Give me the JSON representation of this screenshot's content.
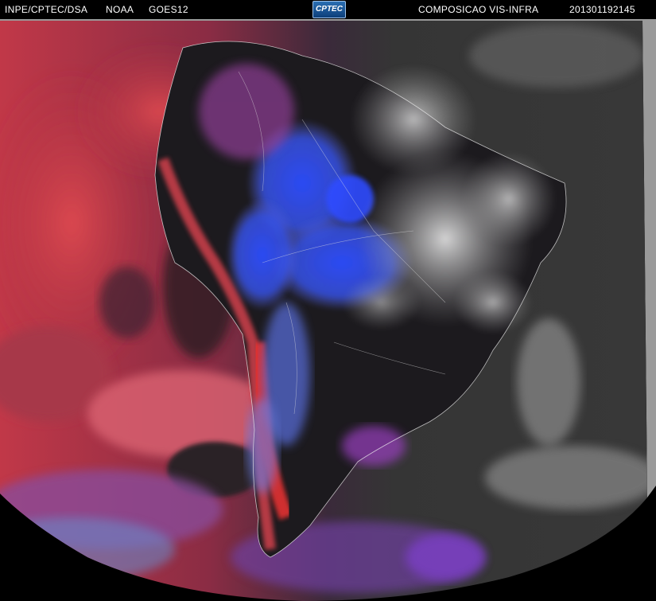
{
  "header": {
    "agency": "INPE/CPTEC/DSA",
    "provider": "NOAA",
    "satellite": "GOES12",
    "logo_text": "CPTEC",
    "product": "COMPOSICAO VIS-INFRA",
    "timestamp": "201301192145"
  },
  "colors": {
    "background": "#000000",
    "ocean_infra": "#c23a4a",
    "ocean_visible": "#3b3b3b",
    "cold_cloud_tops": "#2e55ff",
    "bright_clouds": "#d9d9d9",
    "coastlines": "#f0f0f0"
  },
  "icons": [
    "satellite-earth-disk",
    "cptec-logo"
  ]
}
